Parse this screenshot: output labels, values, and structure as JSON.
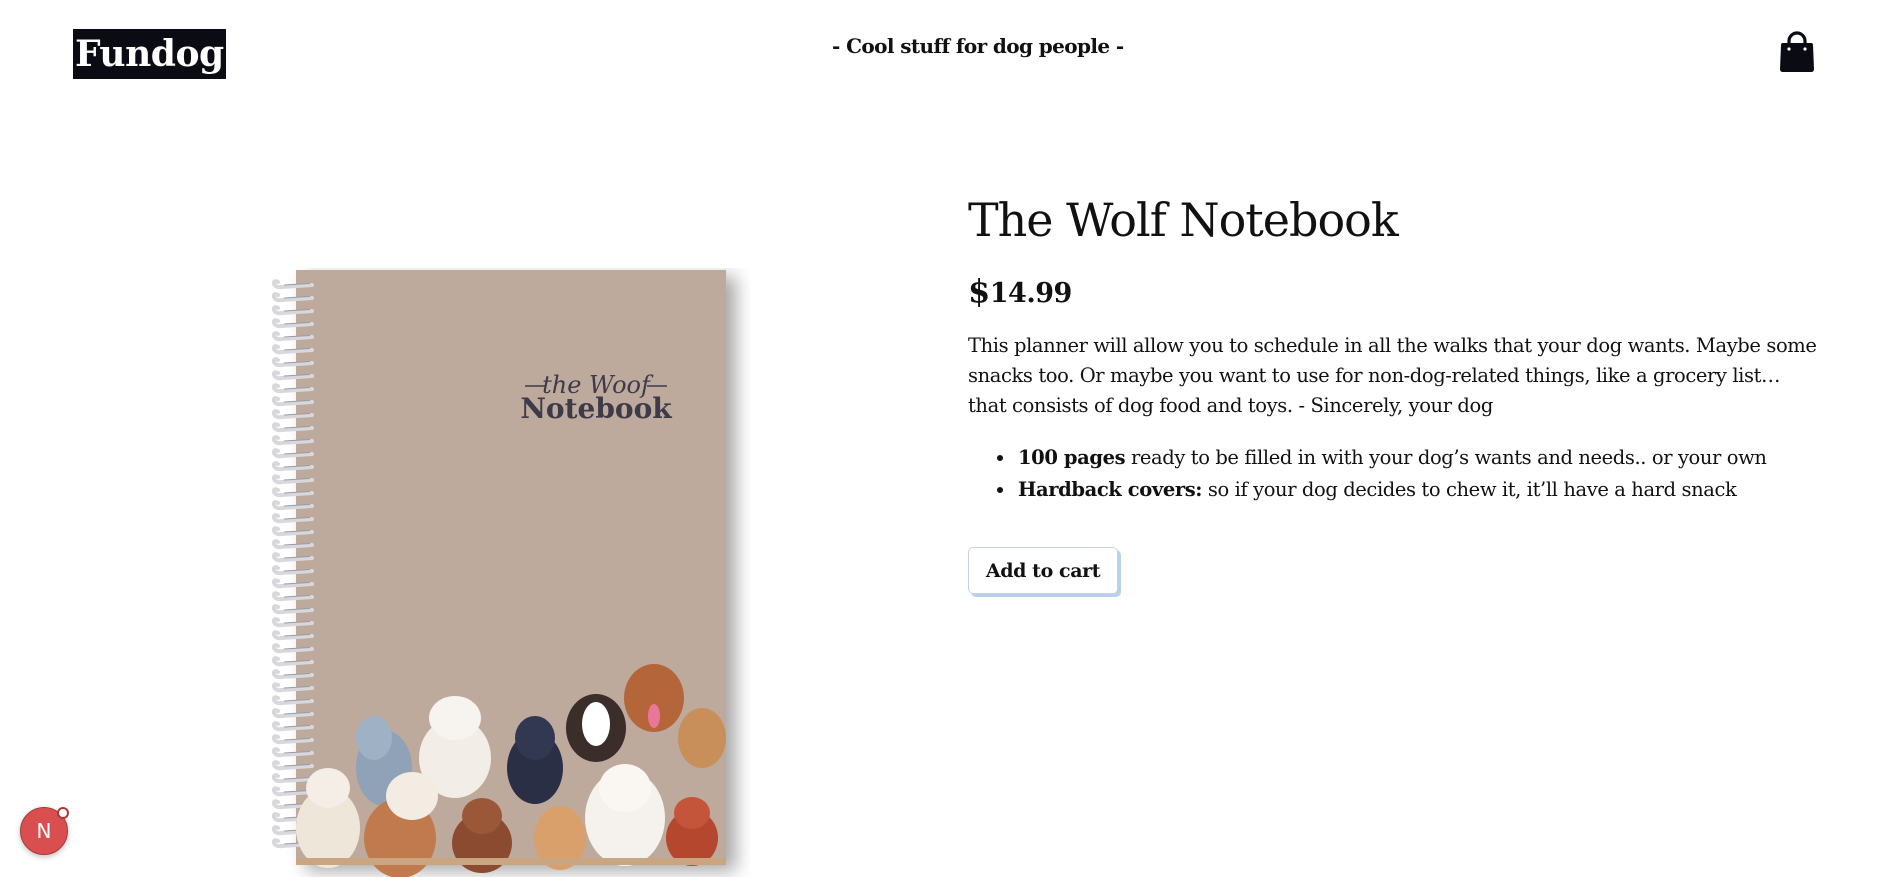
{
  "header": {
    "logo_text": "Fundog",
    "tagline": "- Cool stuff for dog people -",
    "cart_icon": "shopping-bag-icon"
  },
  "product": {
    "title": "The Wolf Notebook",
    "price_currency": "$",
    "price_amount": "14.99",
    "description": "This planner will allow you to schedule in all the walks that your dog wants. Maybe some snacks too. Or maybe you want to use for non-dog-related things, like a grocery list… that consists of dog food and toys. - Sincerely, your dog",
    "features": [
      {
        "bold": "100 pages",
        "text": " ready to be filled in with your dog’s wants and needs.. or your own"
      },
      {
        "bold": "Hardback covers:",
        "text": " so if your dog decides to chew it, it’ll have a hard snack"
      }
    ],
    "add_to_cart_label": "Add to cart",
    "image": {
      "cover_line1": "the Woof",
      "cover_line2": "Notebook",
      "cover_color": "#bdaa9d"
    }
  },
  "badge": {
    "letter": "N",
    "color": "#d94f4f"
  }
}
